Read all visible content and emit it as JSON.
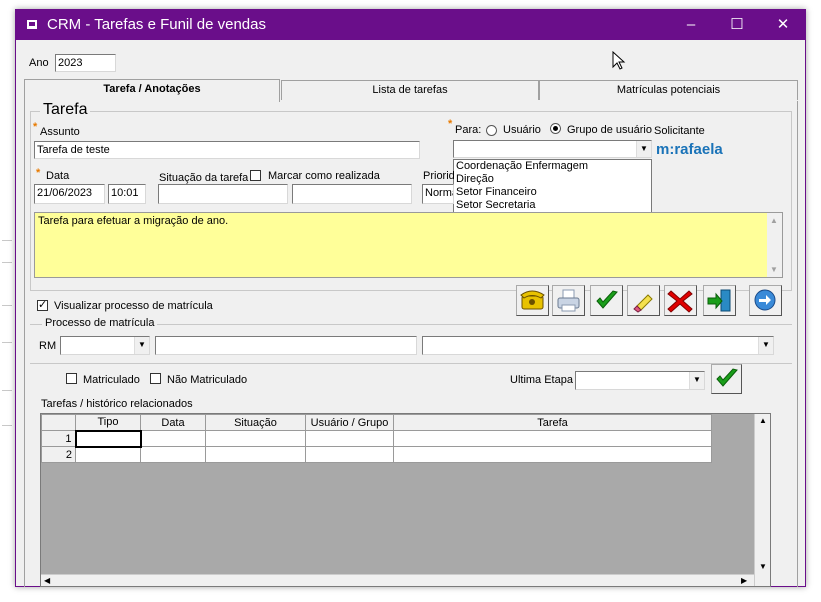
{
  "window": {
    "title": "CRM - Tarefas e Funil de vendas",
    "minimize": "–",
    "maximize": "☐",
    "close": "✕"
  },
  "ano": {
    "label": "Ano",
    "value": "2023"
  },
  "tabs": [
    {
      "label": "Tarefa / Anotações",
      "active": true
    },
    {
      "label": "Lista de tarefas",
      "active": false
    },
    {
      "label": "Matrículas potenciais",
      "active": false
    }
  ],
  "tarefa": {
    "section_title": "Tarefa",
    "assunto_label": "Assunto",
    "assunto_value": "Tarefa de teste",
    "para_label": "Para:",
    "radio_usuario": "Usuário",
    "radio_grupo": "Grupo de usuário",
    "para_selected": "Grupo de usuário",
    "solicitante_label": "Solicitante",
    "solicitante_value": "m:rafaela",
    "group_options": [
      "Coordenação Enfermagem",
      "Direção",
      "Setor Financeiro",
      "Setor Secretaria"
    ],
    "data_label": "Data",
    "data_value": "21/06/2023",
    "hora_value": "10:01",
    "situacao_label": "Situação da tarefa",
    "marcar_label": "Marcar como realizada",
    "prioridade_label": "Priorid",
    "prioridade_value": "Norma",
    "notes": "Tarefa para efetuar a migração de ano."
  },
  "visualizar_label": "Visualizar processo de matrícula",
  "visualizar_checked": true,
  "processo": {
    "legend": "Processo de matrícula",
    "rm_label": "RM",
    "matriculado_label": "Matriculado",
    "nao_matriculado_label": "Não Matriculado",
    "ultima_etapa_label": "Ultima Etapa",
    "historico_label": "Tarefas / histórico relacionados",
    "columns": [
      "Tipo",
      "Data",
      "Situação",
      "Usuário / Grupo",
      "Tarefa"
    ],
    "rows": [
      {
        "num": "1",
        "cells": [
          "",
          "",
          "",
          "",
          ""
        ]
      },
      {
        "num": "2",
        "cells": [
          "",
          "",
          "",
          "",
          ""
        ]
      }
    ]
  },
  "toolbar": [
    "phone-icon",
    "printer-icon",
    "confirm-check-icon",
    "eraser-icon",
    "delete-x-icon",
    "exit-door-icon",
    "next-arrow-icon"
  ],
  "colors": {
    "titlebar": "#6a0e8a",
    "notes_bg": "#ffff99",
    "solicitante": "#1a73b8",
    "check_green": "#1a9e1a",
    "delete_red": "#e00000"
  }
}
